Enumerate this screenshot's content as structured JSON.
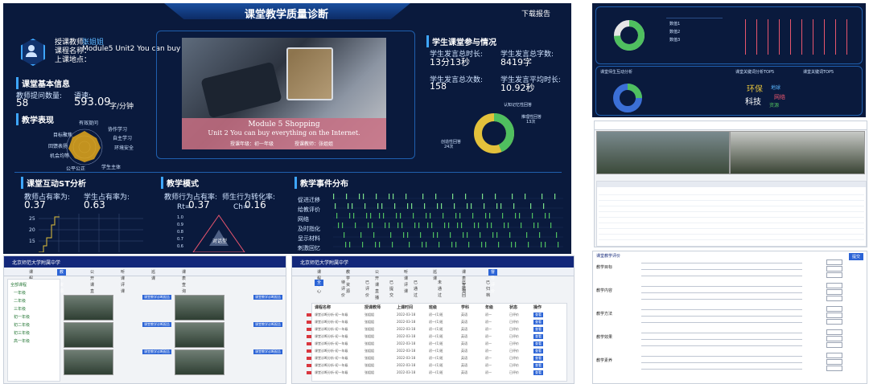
{
  "main": {
    "title": "课堂教学质量诊断",
    "download_label": "下载报告",
    "teacher": {
      "teacher_label": "授课教师：",
      "teacher_value": "张姐姐",
      "course_label": "课程名称：",
      "course_value": "Module5 Unit2 You can buy e...",
      "location_label": "上课地点："
    },
    "basic_info": {
      "title": "课堂基本信息",
      "questions_label": "教师提问数量:",
      "questions_value": "58",
      "speed_label": "语速:",
      "speed_value": "593.09",
      "speed_unit": "字/分钟"
    },
    "performance": {
      "title": "教学表现",
      "radar_labels": [
        "有效提问",
        "协作学习",
        "自主学习",
        "环境安全",
        "学生主体",
        "公平公正",
        "机会均等",
        "回馈表扬",
        "目标聚焦"
      ]
    },
    "video": {
      "line1": "Module 5  Shopping",
      "line2": "Unit 2  You can buy everything on the Internet.",
      "grade_label": "授课年级：初一年级",
      "teacher_label": "授课教师：张姐姐"
    },
    "participation": {
      "title": "学生课堂参与情况",
      "total_time_label": "学生发言总时长:",
      "total_time_value": "13分13秒",
      "total_words_label": "学生发言总字数:",
      "total_words_value": "8419字",
      "count_label": "学生发言总次数:",
      "count_value": "158",
      "avg_label": "学生发言平均时长:",
      "avg_value": "10.92秒",
      "donut_labels": [
        "认知记忆性回答",
        "推理性回答",
        "创造性回答"
      ],
      "donut_label_values": [
        "",
        "13次",
        "24次"
      ]
    },
    "st": {
      "title": "课堂互动ST分析",
      "teacher_ratio_label": "教师占有率为:",
      "teacher_ratio_value": "0.37",
      "student_ratio_label": "学生占有率为:",
      "student_ratio_value": "0.63",
      "y_ticks": [
        "25",
        "20",
        "15"
      ]
    },
    "mode": {
      "title": "教学模式",
      "rt_label": "教师行为占有率:",
      "rt_prefix": "Rt=",
      "rt_value": "0.37",
      "ch_label": "师生行为转化率:",
      "ch_prefix": "Ch=",
      "ch_value": "0.16",
      "y_ticks": [
        "1.0",
        "0.9",
        "0.8",
        "0.7",
        "0.6"
      ],
      "mode_tag": "对话型"
    },
    "events": {
      "title": "教学事件分布",
      "rows": [
        "促进迁移",
        "给教评价",
        "网络",
        "及时指化",
        "呈示材料",
        "刺激回忆"
      ]
    }
  },
  "right_top": {
    "stat_rows": [
      "数值1",
      "数值2",
      "数值3"
    ],
    "section_titles": [
      "课堂师生互动分析",
      "课堂关键词分析TOP5",
      "课堂关键词TOP5"
    ],
    "word_cloud": [
      "环保",
      "科技",
      "地球",
      "网络",
      "资源"
    ]
  },
  "bottom_left": {
    "brand": "北京师范大学附属中学",
    "tabs": [
      "课程中心",
      "教学资源",
      "公开课直播",
      "听课评课",
      "巡课",
      "课表查询"
    ],
    "tree": [
      "全部课程",
      "一年级",
      "二年级",
      "三年级",
      "初一年级",
      "初二年级",
      "初三年级",
      "高一年级"
    ],
    "thumb_tag": "课堂教学诊断报告"
  },
  "bottom_mid": {
    "brand": "北京师范大学附属中学",
    "tabs": [
      "课程中心",
      "教学资源",
      "公开课直播",
      "听课评课",
      "巡课",
      "课表查询",
      "督导评价"
    ],
    "filter_tabs": [
      "全部",
      "待评价",
      "已评价",
      "已提交",
      "已通过",
      "未通过",
      "已撤回",
      "已归档"
    ],
    "headers": [
      "课程名称",
      "授课教师",
      "上课时间",
      "班级",
      "学科",
      "年级",
      "状态",
      "操作"
    ],
    "row_template": [
      "课堂诊断分析-初一年级",
      "张姐姐",
      "2022-03-18",
      "初一(1)班",
      "英语",
      "初一",
      "已评价",
      "查看"
    ]
  },
  "bottom_right": {
    "title": "课堂教学评价",
    "sections": [
      "教学目标",
      "教学内容",
      "教学方法",
      "教学效果",
      "教学素养"
    ],
    "submit_label": "提交"
  }
}
